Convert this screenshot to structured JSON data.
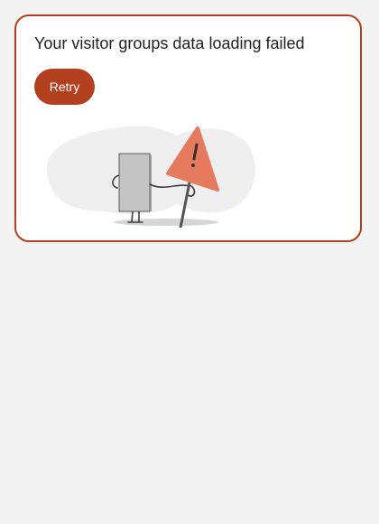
{
  "error_card": {
    "title": "Your visitor groups data loading failed",
    "retry_label": "Retry",
    "illustration": {
      "blob_color": "#efefef",
      "document_color": "#c4c4c4",
      "sign_color": "#e57a5e",
      "sign_icon": "warning-sign-icon"
    }
  },
  "colors": {
    "accent": "#b3401f",
    "background": "#f3f3f3",
    "card": "#ffffff",
    "text": "#202124"
  }
}
